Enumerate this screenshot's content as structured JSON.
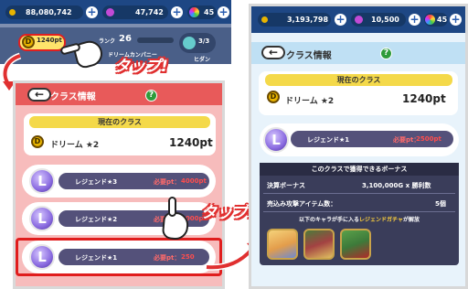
{
  "left": {
    "topbar": {
      "money": "88,080,742",
      "gems": "47,742",
      "stamina": "45",
      "plus": "+"
    },
    "class_chip_text": "1240pt",
    "rank_label": "ランク",
    "rank_value": "26",
    "rank_name": "ドリームカンパニー",
    "count_value": "3/3",
    "count_sub": "ヒダン",
    "panel_title": "クラス情報",
    "current_class_header": "現在のクラス",
    "current_class_name": "ドリーム ★2",
    "current_class_pt": "1240pt",
    "rows": [
      {
        "name": "レジェンド★3",
        "req_label": "必要pt：",
        "req_value": "4000pt"
      },
      {
        "name": "レジェンド★2",
        "req_label": "必要pt：",
        "req_value": "3000pt"
      },
      {
        "name": "レジェンド★1",
        "req_label": "必要pt：",
        "req_value": "250"
      }
    ]
  },
  "tap_label_1": "タップ!",
  "tap_label_2": "タップ!",
  "right": {
    "topbar": {
      "money": "3,193,798",
      "gems": "10,500",
      "stamina": "45",
      "plus": "+"
    },
    "panel_title": "クラス情報",
    "current_class_header": "現在のクラス",
    "current_class_name": "ドリーム ★2",
    "current_class_pt": "1240pt",
    "legend_row": {
      "name": "レジェンド★1",
      "req_label": "必要pt：",
      "req_value": "2500pt"
    },
    "bonus_header": "このクラスで獲得できるボーナス",
    "bonus_rows": [
      {
        "label": "決算ボーナス",
        "value": "3,100,000G x 勝利数"
      },
      {
        "label": "売込み攻撃アイテム数：",
        "value": "5個"
      }
    ],
    "gacha_prefix": "以下のキャラが手に入る",
    "gacha_highlight": "レジェンドガチャ",
    "gacha_suffix": "が解放"
  },
  "icons": {
    "coin": "coin-icon",
    "gem": "gem-icon",
    "stamina": "stamina-orb-icon",
    "back": "back-arrow-icon",
    "help": "help-icon",
    "medal": "legend-medal-icon",
    "hand": "pointing-hand-icon",
    "arrow": "curved-arrow-icon"
  },
  "colors": {
    "left_title_bar": "#e85a5a",
    "right_title_bar": "#bfe0f4",
    "highlight": "#e01d1d",
    "topbar": "#1e4784",
    "gold": "#f4d94a"
  }
}
